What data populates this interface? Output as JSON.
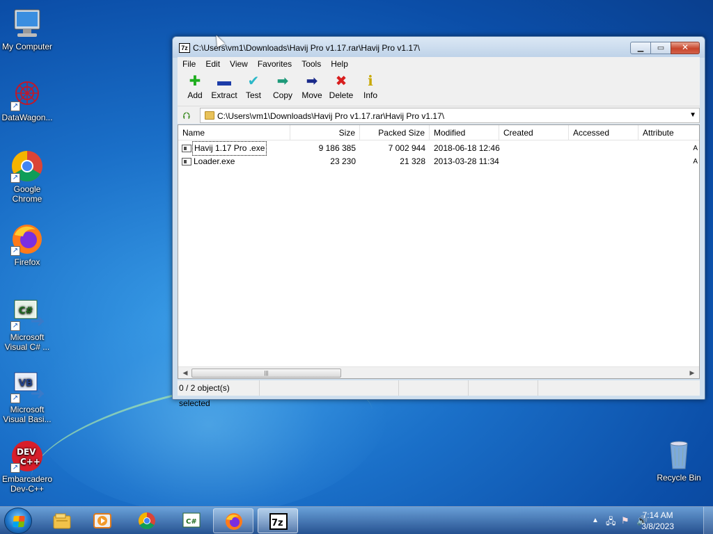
{
  "desktop": {
    "icons": [
      {
        "label": "My Computer",
        "icon": "computer-icon"
      },
      {
        "label": "DataWagon...",
        "icon": "datawagon-icon"
      },
      {
        "label": "Google Chrome",
        "icon": "chrome-icon"
      },
      {
        "label": "Firefox",
        "icon": "firefox-icon"
      },
      {
        "label": "Microsoft Visual C# ...",
        "icon": "visual-csharp-icon"
      },
      {
        "label": "Microsoft Visual Basi...",
        "icon": "visual-basic-icon"
      },
      {
        "label": "Embarcadero Dev-C++",
        "icon": "devcpp-icon"
      },
      {
        "label": "Recycle Bin",
        "icon": "recycle-bin-icon"
      }
    ]
  },
  "window": {
    "title": "C:\\Users\\vm1\\Downloads\\Havij Pro v1.17.rar\\Havij Pro v1.17\\",
    "app_icon_text": "7z",
    "menu": [
      "File",
      "Edit",
      "View",
      "Favorites",
      "Tools",
      "Help"
    ],
    "toolbar": [
      {
        "label": "Add",
        "icon": "add-icon",
        "glyph": "✚",
        "color": "#1fae1f"
      },
      {
        "label": "Extract",
        "icon": "extract-icon",
        "glyph": "▬",
        "color": "#1c3ca8"
      },
      {
        "label": "Test",
        "icon": "test-icon",
        "glyph": "✔",
        "color": "#2bb8c8"
      },
      {
        "label": "Copy",
        "icon": "copy-icon",
        "glyph": "➡",
        "color": "#1e9a7a"
      },
      {
        "label": "Move",
        "icon": "move-icon",
        "glyph": "➡",
        "color": "#1a2a8a"
      },
      {
        "label": "Delete",
        "icon": "delete-icon",
        "glyph": "✖",
        "color": "#d81e1e"
      },
      {
        "label": "Info",
        "icon": "info-icon",
        "glyph": "ℹ",
        "color": "#c8a800"
      }
    ],
    "address": "C:\\Users\\vm1\\Downloads\\Havij Pro v1.17.rar\\Havij Pro v1.17\\",
    "columns": [
      "Name",
      "Size",
      "Packed Size",
      "Modified",
      "Created",
      "Accessed",
      "Attribute"
    ],
    "files": [
      {
        "name": "Havij 1.17 Pro .exe",
        "size": "9 186 385",
        "packed": "7 002 944",
        "modified": "2018-06-18 12:46",
        "attr": "A"
      },
      {
        "name": "Loader.exe",
        "size": "23 230",
        "packed": "21 328",
        "modified": "2013-03-28 11:34",
        "attr": "A"
      }
    ],
    "status": "0 / 2 object(s) selected"
  },
  "taskbar": {
    "apps": [
      "file-explorer-icon",
      "media-player-icon",
      "chrome-icon",
      "visual-csharp-icon",
      "firefox-icon",
      "7zip-icon"
    ],
    "clock_time": "7:14 AM",
    "clock_date": "3/8/2023"
  }
}
